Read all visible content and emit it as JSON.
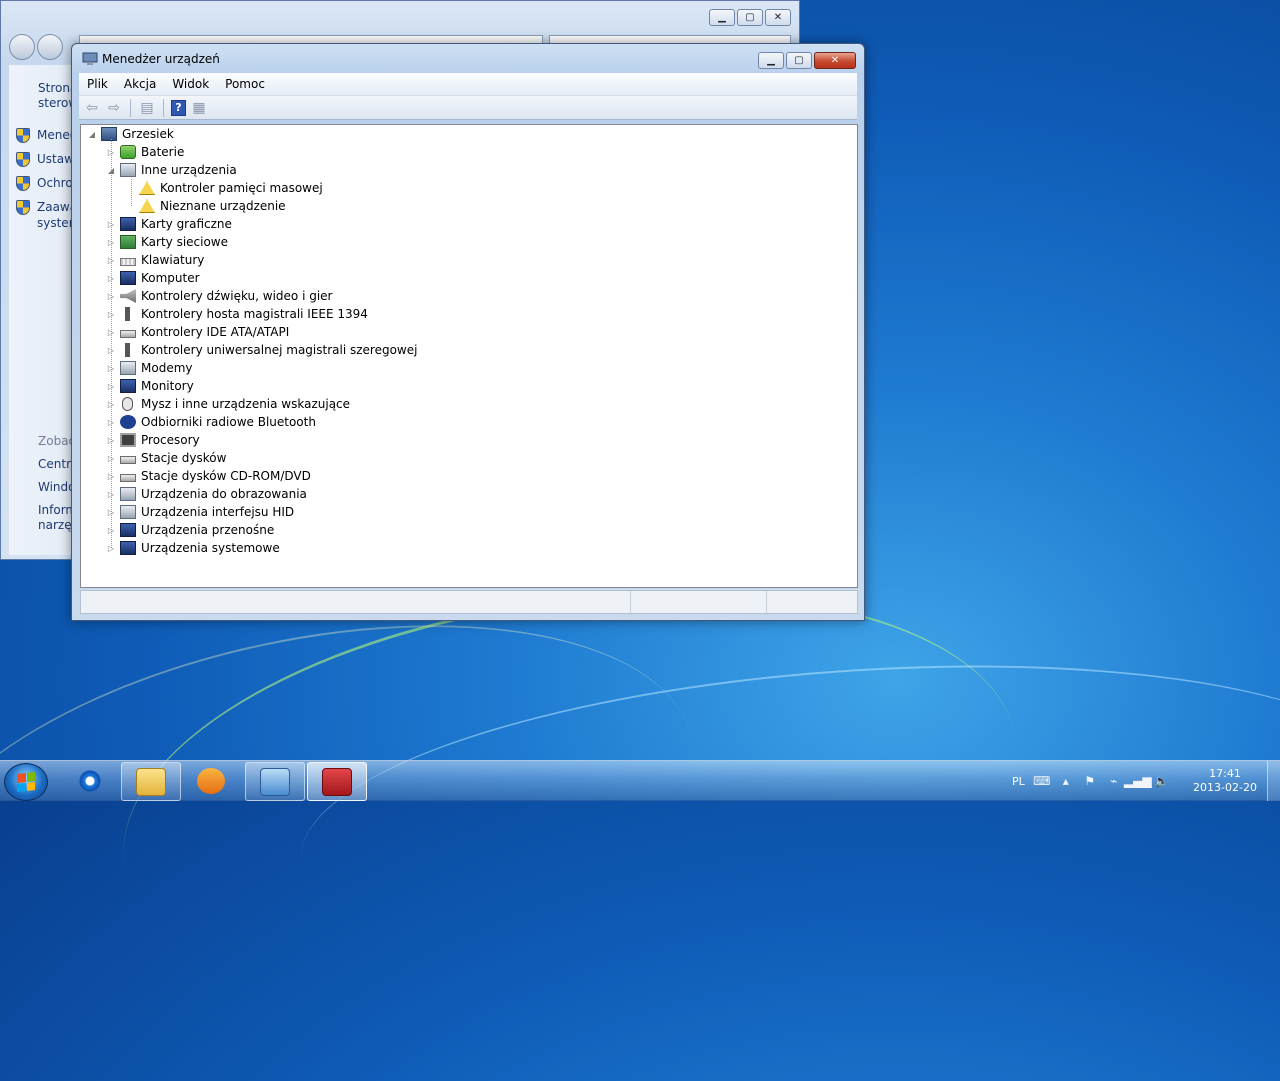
{
  "background_window": {
    "sidebar_links": [
      "Strona",
      "sterow",
      "Mened",
      "Ustawi",
      "Ochro",
      "Zaawa",
      "system"
    ],
    "see_also_heading": "Zobac",
    "see_also_links": [
      "Centru",
      "Windo",
      "Inform",
      "narzęd"
    ]
  },
  "window": {
    "title": "Menedżer urządzeń",
    "menu": [
      "Plik",
      "Akcja",
      "Widok",
      "Pomoc"
    ],
    "toolbar_icons": [
      "back-arrow-icon",
      "forward-arrow-icon",
      "show-hide-tree-icon",
      "help-icon",
      "properties-icon"
    ]
  },
  "tree": {
    "root": "Grzesiek",
    "items": [
      {
        "label": "Baterie",
        "icon": "battery-icon",
        "expanded": false
      },
      {
        "label": "Inne urządzenia",
        "icon": "unknown-device-icon",
        "expanded": true,
        "children": [
          {
            "label": "Kontroler pamięci masowej",
            "icon": "warning-device-icon"
          },
          {
            "label": "Nieznane urządzenie",
            "icon": "warning-device-icon"
          }
        ]
      },
      {
        "label": "Karty graficzne",
        "icon": "display-adapter-icon",
        "expanded": false
      },
      {
        "label": "Karty sieciowe",
        "icon": "network-adapter-icon",
        "expanded": false
      },
      {
        "label": "Klawiatury",
        "icon": "keyboard-icon",
        "expanded": false
      },
      {
        "label": "Komputer",
        "icon": "computer-icon",
        "expanded": false
      },
      {
        "label": "Kontrolery dźwięku, wideo i gier",
        "icon": "speaker-icon",
        "expanded": false
      },
      {
        "label": "Kontrolery hosta magistrali IEEE 1394",
        "icon": "firewire-icon",
        "expanded": false
      },
      {
        "label": "Kontrolery IDE ATA/ATAPI",
        "icon": "ide-controller-icon",
        "expanded": false
      },
      {
        "label": "Kontrolery uniwersalnej magistrali szeregowej",
        "icon": "usb-icon",
        "expanded": false
      },
      {
        "label": "Modemy",
        "icon": "modem-icon",
        "expanded": false
      },
      {
        "label": "Monitory",
        "icon": "monitor-icon",
        "expanded": false
      },
      {
        "label": "Mysz i inne urządzenia wskazujące",
        "icon": "mouse-icon",
        "expanded": false
      },
      {
        "label": "Odbiorniki radiowe Bluetooth",
        "icon": "bluetooth-icon",
        "expanded": false
      },
      {
        "label": "Procesory",
        "icon": "processor-icon",
        "expanded": false
      },
      {
        "label": "Stacje dysków",
        "icon": "disk-drive-icon",
        "expanded": false
      },
      {
        "label": "Stacje dysków CD-ROM/DVD",
        "icon": "dvd-drive-icon",
        "expanded": false
      },
      {
        "label": "Urządzenia do obrazowania",
        "icon": "camera-icon",
        "expanded": false
      },
      {
        "label": "Urządzenia interfejsu HID",
        "icon": "hid-icon",
        "expanded": false
      },
      {
        "label": "Urządzenia przenośne",
        "icon": "portable-device-icon",
        "expanded": false
      },
      {
        "label": "Urządzenia systemowe",
        "icon": "system-device-icon",
        "expanded": false
      }
    ]
  },
  "taskbar": {
    "pinned": [
      "internet-explorer-icon",
      "explorer-folder-icon",
      "media-player-icon",
      "control-panel-icon",
      "device-manager-icon"
    ],
    "language": "PL",
    "time": "17:41",
    "date": "2013-02-20"
  }
}
